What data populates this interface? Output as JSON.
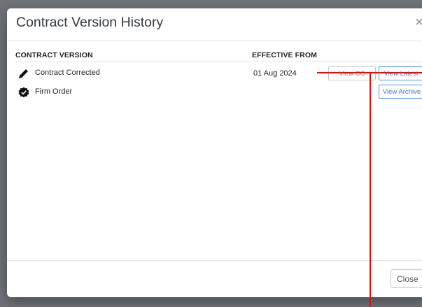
{
  "dialog": {
    "title": "Contract Version History",
    "close_glyph": "×"
  },
  "table": {
    "columns": [
      "CONTRACT VERSION",
      "EFFECTIVE FROM"
    ],
    "rows": [
      {
        "label": "Contract Corrected",
        "icon": "pencil-icon",
        "effective_from": "01 Aug 2024",
        "actions": [
          "View CC",
          "View Latest"
        ]
      },
      {
        "label": "Firm Order",
        "icon": "verified-badge-icon",
        "effective_from": "",
        "actions": [
          "View Archive"
        ]
      }
    ]
  },
  "footer": {
    "close_label": "Close"
  },
  "colors": {
    "accent_blue": "#2f7bd3",
    "annotation_red": "#dd1111"
  }
}
